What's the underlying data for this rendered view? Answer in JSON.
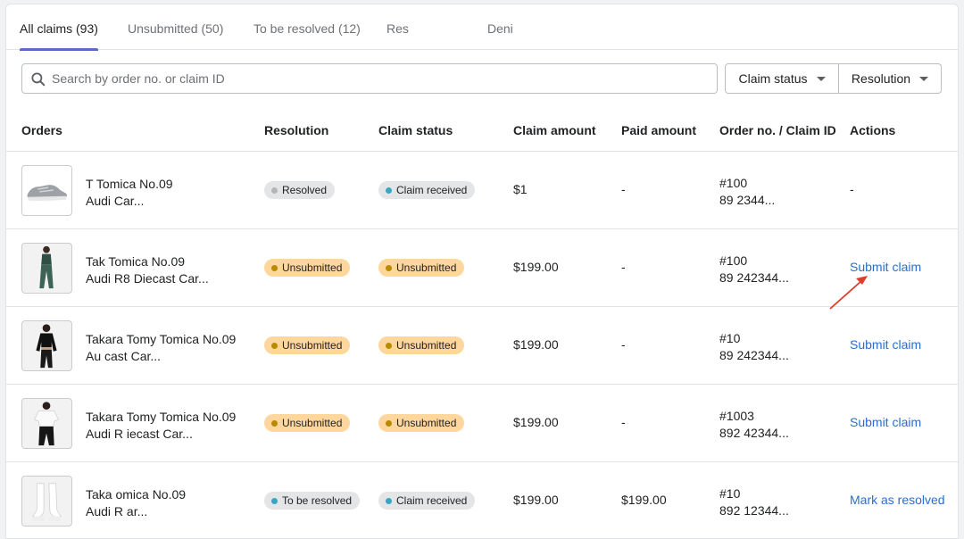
{
  "tabs": [
    {
      "label": "All claims (93)",
      "active": true
    },
    {
      "label": "Unsubmitted (50)",
      "active": false
    },
    {
      "label": "To be resolved (12)",
      "active": false
    },
    {
      "label": "Res",
      "active": false
    },
    {
      "label": "Deni",
      "active": false
    }
  ],
  "search": {
    "placeholder": "Search by order no. or claim ID",
    "value": "",
    "icon": "search-icon"
  },
  "filters": [
    {
      "label": "Claim status",
      "icon": "caret-down-icon"
    },
    {
      "label": "Resolution",
      "icon": "caret-down-icon"
    }
  ],
  "columns": [
    "Orders",
    "Resolution",
    "Claim status",
    "Claim amount",
    "Paid amount",
    "Order no. / Claim ID",
    "Actions"
  ],
  "rows": [
    {
      "image": "sneaker",
      "line1": "T Tomica No.09",
      "line2": "Audi Car...",
      "resolution": "Resolved",
      "claim_status": "Claim received",
      "claim_amount": "$1",
      "paid_amount": "-",
      "order_no": "#100",
      "claim_id": "89 2344...",
      "action": "-"
    },
    {
      "image": "leggings",
      "line1": "Tak Tomica No.09",
      "line2": "Audi R8 Diecast Car...",
      "resolution": "Unsubmitted",
      "claim_status": "Unsubmitted",
      "claim_amount": "$199.00",
      "paid_amount": "-",
      "order_no": "#100",
      "claim_id": "89 242344...",
      "action": "Submit claim"
    },
    {
      "image": "crop-top",
      "line1": "Takara Tomy Tomica No.09",
      "line2": "Au cast Car...",
      "resolution": "Unsubmitted",
      "claim_status": "Unsubmitted",
      "claim_amount": "$199.00",
      "paid_amount": "-",
      "order_no": "#10",
      "claim_id": "89 242344...",
      "action": "Submit claim"
    },
    {
      "image": "tshirt",
      "line1": "Takara Tomy Tomica No.09",
      "line2": "Audi R iecast Car...",
      "resolution": "Unsubmitted",
      "claim_status": "Unsubmitted",
      "claim_amount": "$199.00",
      "paid_amount": "-",
      "order_no": "#1003",
      "claim_id": "892 42344...",
      "action": "Submit claim"
    },
    {
      "image": "socks",
      "line1": "Taka omica No.09",
      "line2": "Audi R ar...",
      "resolution": "To be resolved",
      "claim_status": "Claim received",
      "claim_amount": "$199.00",
      "paid_amount": "$199.00",
      "order_no": "#10",
      "claim_id": "892 12344...",
      "action": "Mark as resolved"
    }
  ],
  "colors": {
    "accent": "#5c6ac4",
    "link": "#2c6ecb",
    "badge_attention": "#ffd79d",
    "badge_neutral": "#e4e5e7",
    "annotation_arrow": "#e03c2c"
  }
}
